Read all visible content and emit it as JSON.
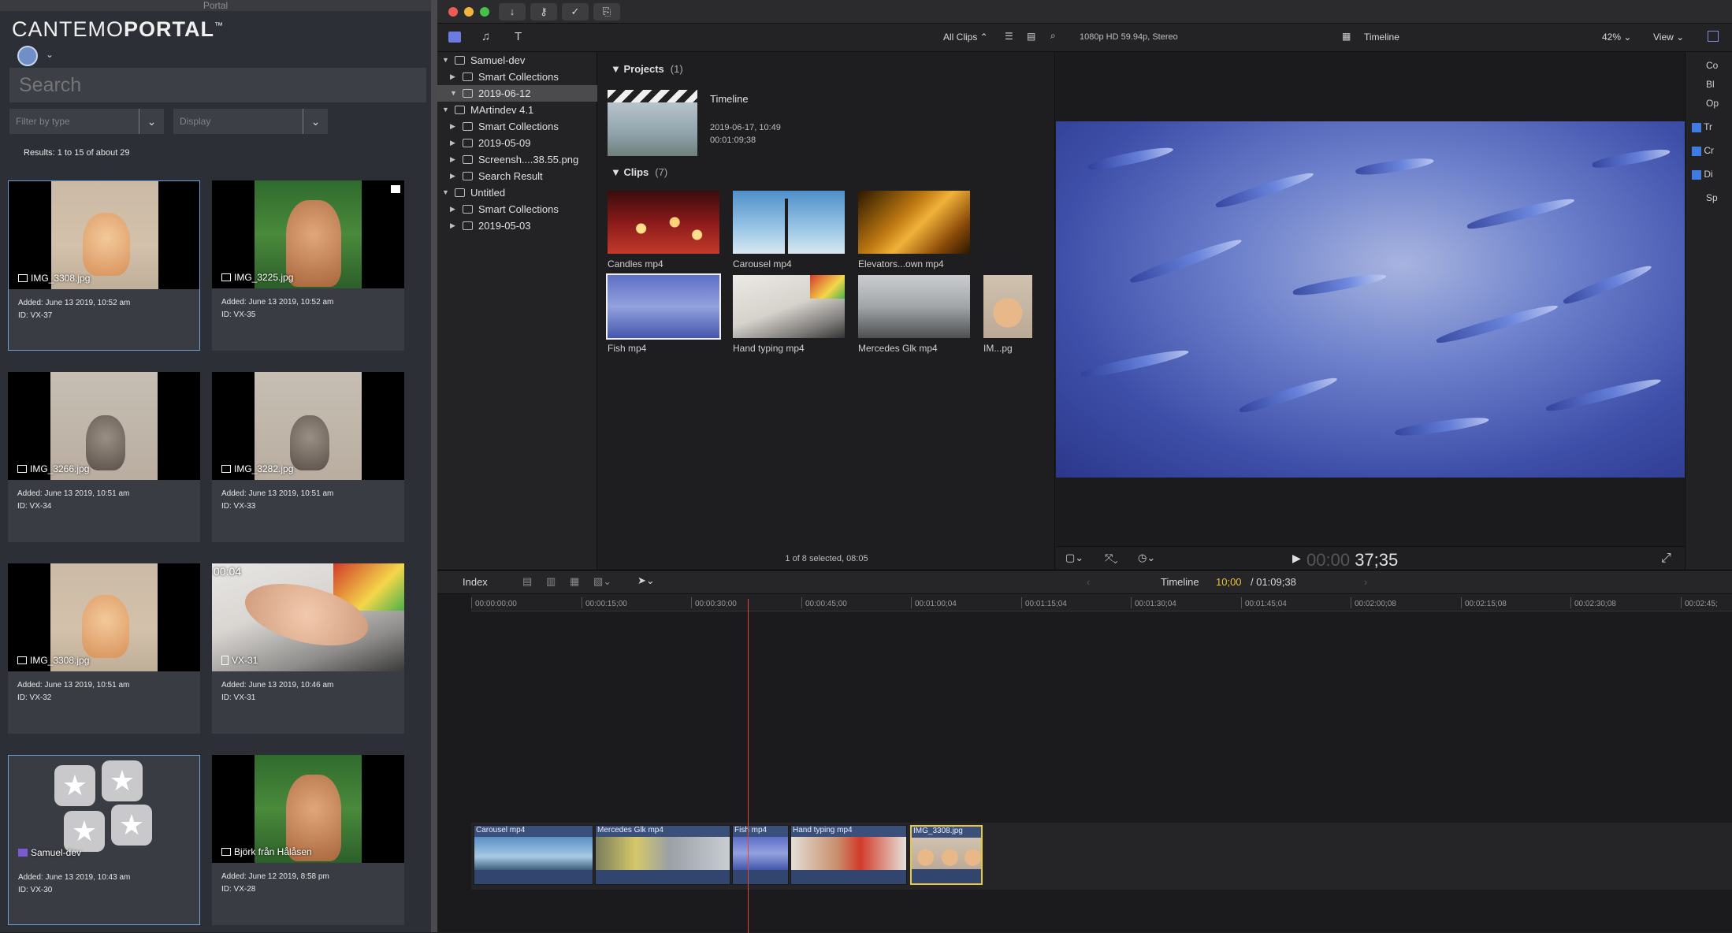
{
  "portal": {
    "window_title": "Portal",
    "logo_light": "CANTEMO",
    "logo_bold": "PORTAL",
    "logo_tm": "™",
    "search_placeholder": "Search",
    "filter_placeholder": "Filter by type",
    "display_placeholder": "Display",
    "results_text": "Results: 1 to 15 of about 29",
    "cards": [
      {
        "name": "IMG_3308.jpg",
        "added": "Added: June 13 2019, 10:52 am",
        "id": "ID: VX-37"
      },
      {
        "name": "IMG_3225.jpg",
        "added": "Added: June 13 2019, 10:52 am",
        "id": "ID: VX-35"
      },
      {
        "name": "IMG_3266.jpg",
        "added": "Added: June 13 2019, 10:51 am",
        "id": "ID: VX-34"
      },
      {
        "name": "IMG_3282.jpg",
        "added": "Added: June 13 2019, 10:51 am",
        "id": "ID: VX-33"
      },
      {
        "name": "IMG_3308.jpg",
        "added": "Added: June 13 2019, 10:51 am",
        "id": "ID: VX-32"
      },
      {
        "name": "VX-31",
        "added": "Added: June 13 2019, 10:46 am",
        "id": "ID: VX-31",
        "overlay": "00:04"
      },
      {
        "name": "Samuel-dev",
        "added": "Added: June 13 2019, 10:43 am",
        "id": "ID: VX-30"
      },
      {
        "name": "Björk från Hålåsen",
        "added": "Added: June 12 2019, 8:58 pm",
        "id": "ID: VX-28"
      }
    ]
  },
  "fcp": {
    "browser_filter": "All Clips",
    "format_info": "1080p HD 59.94p, Stereo",
    "viewer_title": "Timeline",
    "zoom": "42%",
    "view_menu": "View",
    "library": [
      {
        "label": "Samuel-dev",
        "kind": "library",
        "open": true
      },
      {
        "label": "Smart Collections",
        "kind": "folder",
        "open": false
      },
      {
        "label": "2019-06-12",
        "kind": "event",
        "open": true,
        "selected": true
      },
      {
        "label": "MArtindev 4.1",
        "kind": "library",
        "open": true
      },
      {
        "label": "Smart Collections",
        "kind": "folder",
        "open": false
      },
      {
        "label": "2019-05-09",
        "kind": "event",
        "open": false
      },
      {
        "label": "Screensh....38.55.png",
        "kind": "event",
        "open": false
      },
      {
        "label": "Search Result",
        "kind": "event",
        "open": false
      },
      {
        "label": "Untitled",
        "kind": "library",
        "open": true
      },
      {
        "label": "Smart Collections",
        "kind": "folder",
        "open": false
      },
      {
        "label": "2019-05-03",
        "kind": "event",
        "open": false
      }
    ],
    "projects_label": "Projects",
    "projects_count": "(1)",
    "project": {
      "name": "Timeline",
      "date": "2019-06-17, 10:49",
      "duration": "00:01:09;38"
    },
    "clips_label": "Clips",
    "clips_count": "(7)",
    "clips": [
      {
        "label": "Candles mp4"
      },
      {
        "label": "Carousel mp4"
      },
      {
        "label": "Elevators...own mp4"
      },
      {
        "label": "Fish mp4"
      },
      {
        "label": "Hand typing mp4"
      },
      {
        "label": "Mercedes Glk mp4"
      },
      {
        "label": "IM...pg"
      }
    ],
    "browser_status": "1 of 8 selected, 08:05",
    "timecode_dim": "00:00",
    "timecode_bright": "37;35",
    "inspector_labels": [
      "Co",
      "Bl",
      "Op",
      "Tr",
      "Cr",
      "Di",
      "Sp"
    ],
    "timeline_index": "Index",
    "timeline_name": "Timeline",
    "timeline_position": "10;00",
    "timeline_total": "/ 01:09;38",
    "ruler": [
      "00:00:00;00",
      "00:00:15;00",
      "00:00:30;00",
      "00:00:45;00",
      "00:01:00;04",
      "00:01:15;04",
      "00:01:30;04",
      "00:01:45;04",
      "00:02:00;08",
      "00:02:15;08",
      "00:02:30;08",
      "00:02:45;"
    ],
    "timeline_clips": [
      {
        "label": "Carousel mp4"
      },
      {
        "label": "Mercedes Glk mp4"
      },
      {
        "label": "Fish mp4"
      },
      {
        "label": "Hand typing mp4"
      },
      {
        "label": "IMG_3308.jpg",
        "selected": true
      }
    ]
  }
}
